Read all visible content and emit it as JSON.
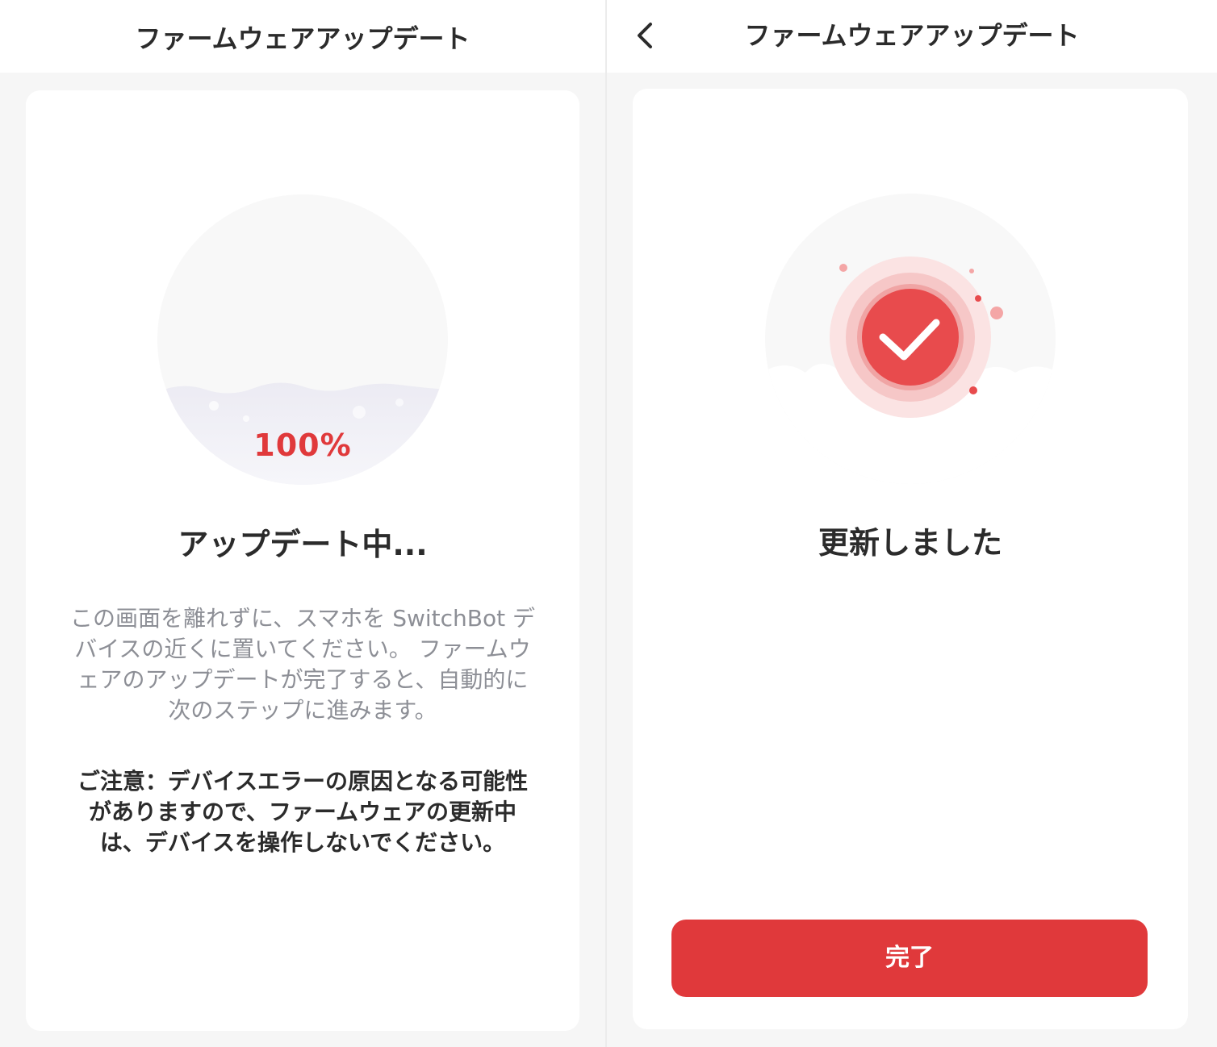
{
  "left_screen": {
    "header": {
      "title": "ファームウェアアップデート"
    },
    "progress": {
      "percent_label": "100%",
      "value": 100
    },
    "status": {
      "title": "アップデート中..."
    },
    "description": "この画面を離れずに、スマホを SwitchBot デバイスの近くに置いてください。 ファームウェアのアップデートが完了すると、自動的に次のステップに進みます。",
    "warning": "ご注意：デバイスエラーの原因となる可能性がありますので、ファームウェアの更新中は、デバイスを操作しないでください。"
  },
  "right_screen": {
    "header": {
      "title": "ファームウェアアップデート",
      "back_icon": "chevron-left-icon"
    },
    "status": {
      "title": "更新しました",
      "icon": "check-icon"
    },
    "done_button": {
      "label": "完了"
    }
  },
  "colors": {
    "accent": "#e0393b",
    "page_background": "#f6f6f6",
    "card_background": "#ffffff",
    "text_primary": "#2b2b2b",
    "text_secondary": "#8d8f96"
  }
}
